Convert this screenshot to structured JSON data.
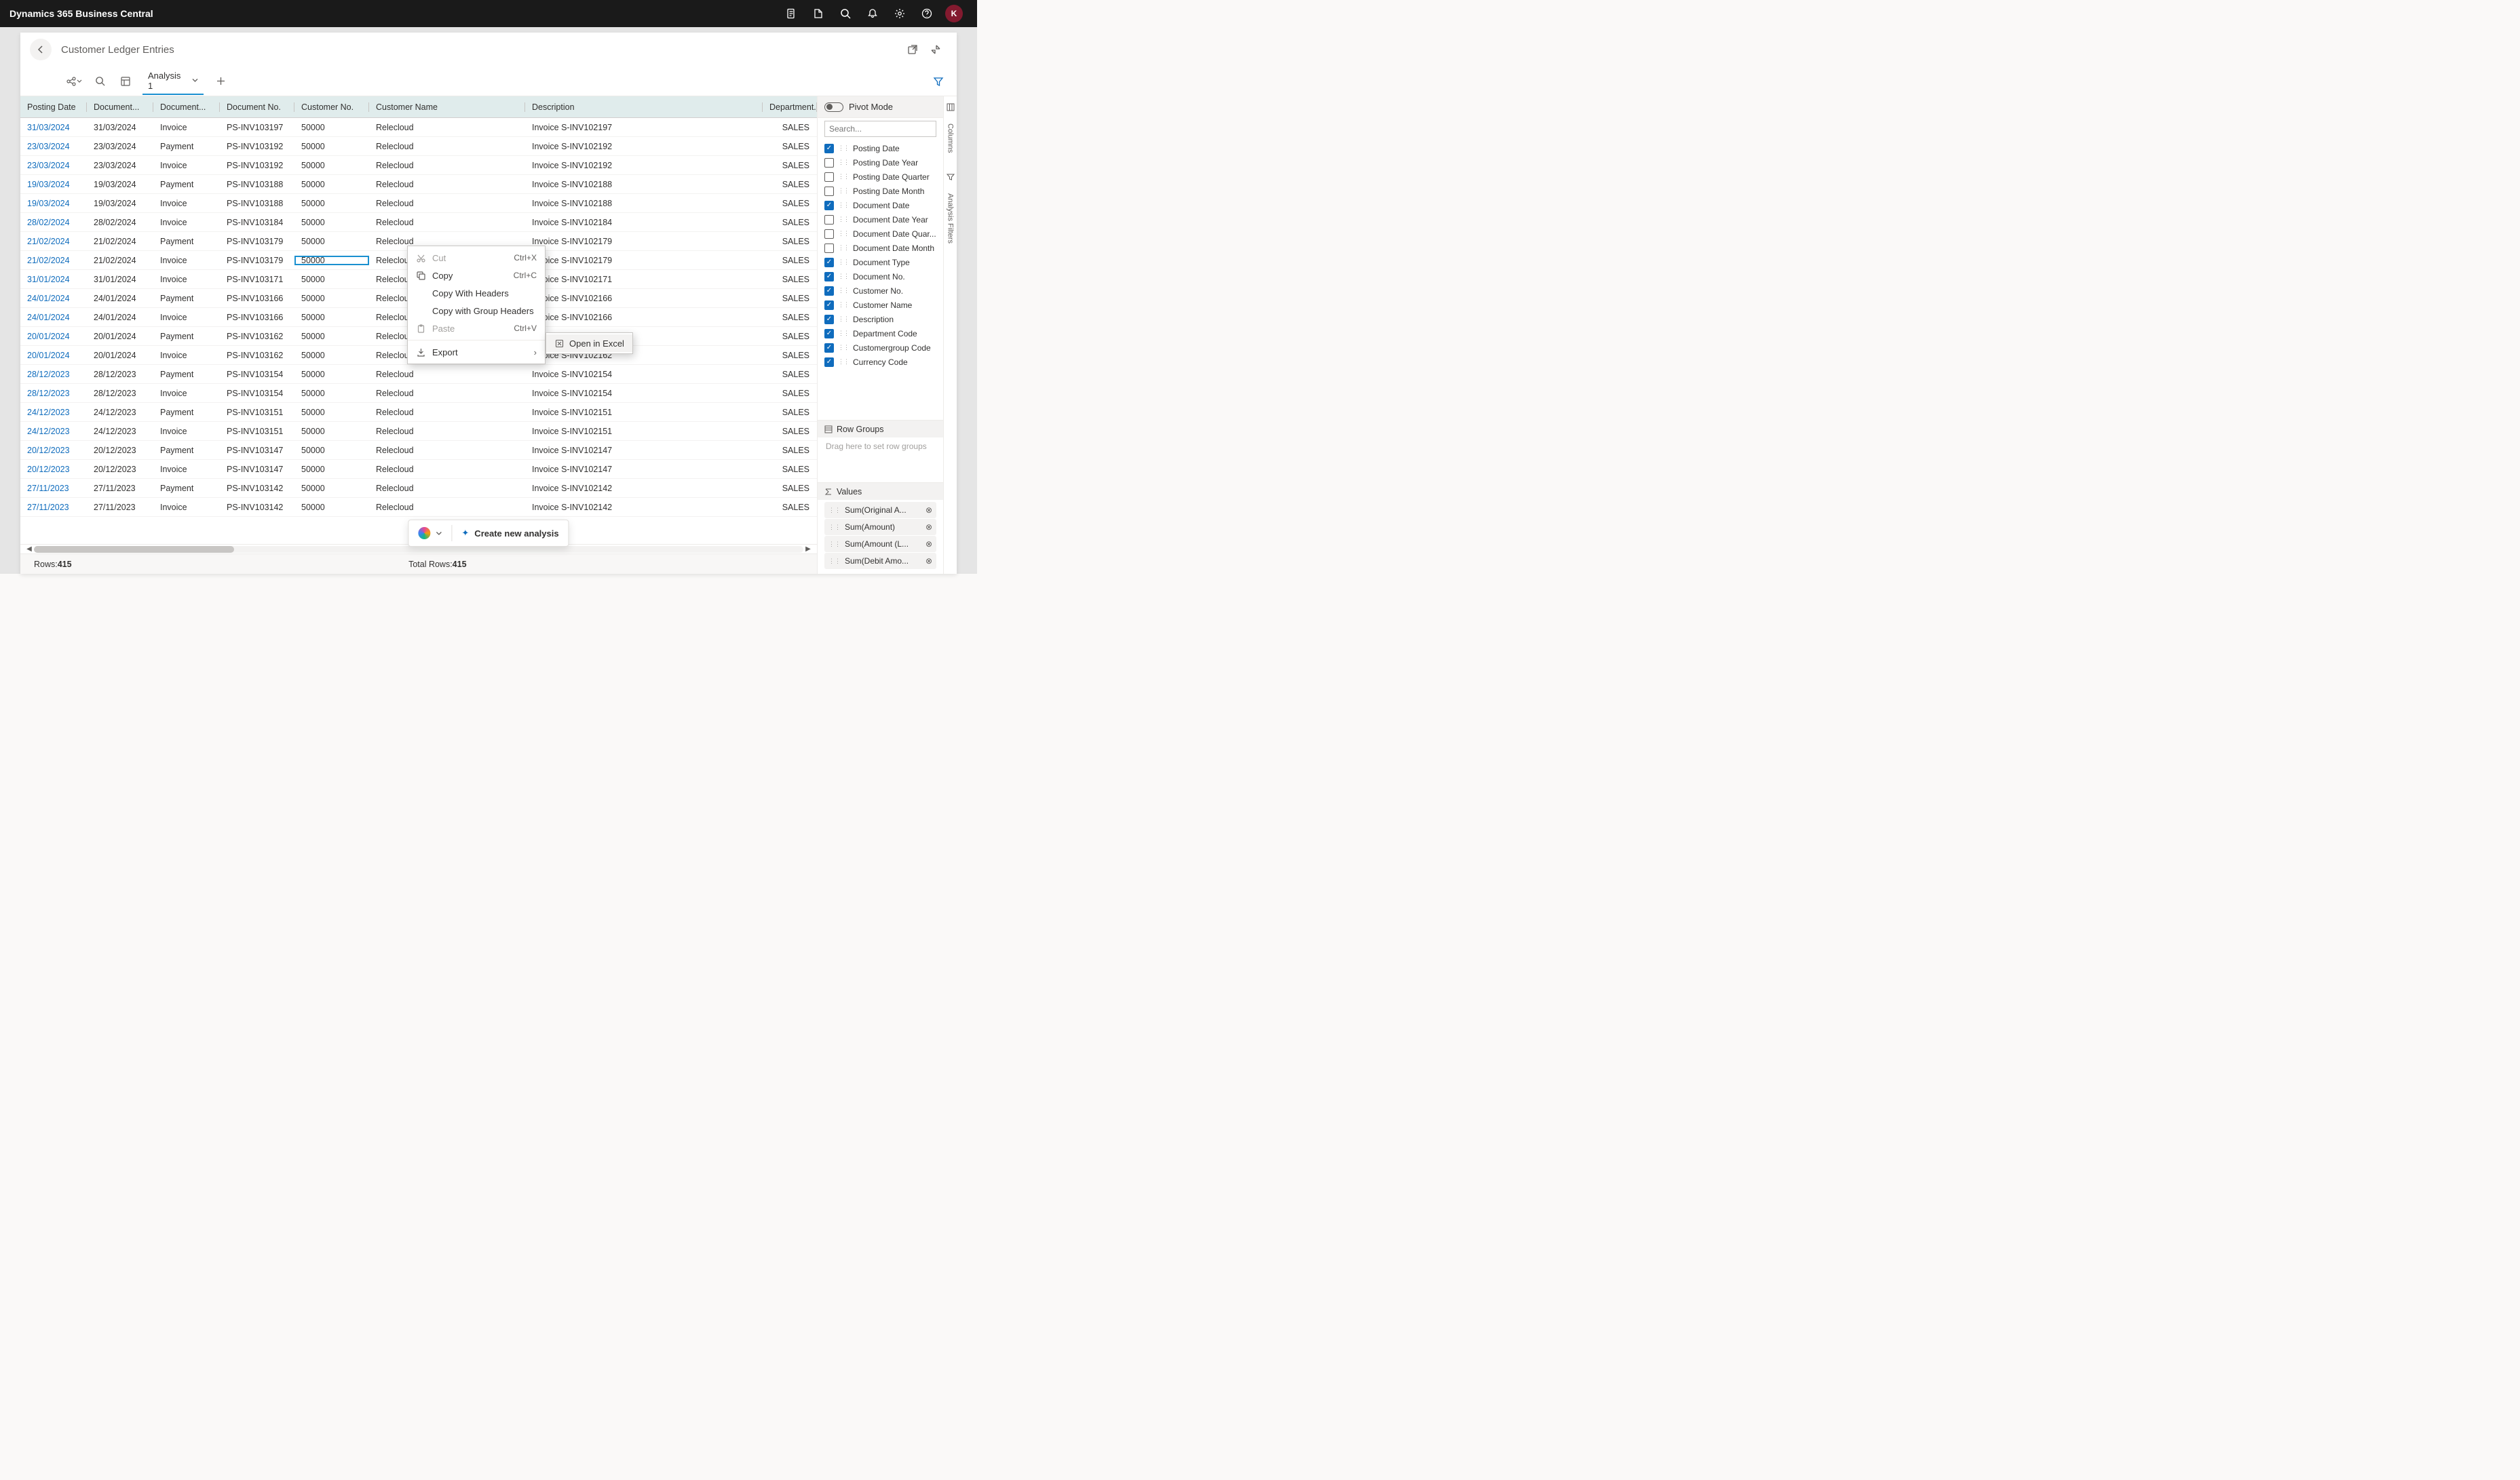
{
  "topbar": {
    "title": "Dynamics 365 Business Central",
    "avatar": "K"
  },
  "header": {
    "title": "Customer Ledger Entries"
  },
  "toolbar": {
    "tab": "Analysis 1"
  },
  "columns": {
    "posting_date": "Posting Date",
    "document_date": "Document...",
    "document_type": "Document...",
    "document_no": "Document No.",
    "customer_no": "Customer No.",
    "customer_name": "Customer Name",
    "description": "Description",
    "department": "Department..."
  },
  "rows": [
    {
      "pd": "31/03/2024",
      "dd": "31/03/2024",
      "dt": "Invoice",
      "dn": "PS-INV103197",
      "cn": "50000",
      "name": "Relecloud",
      "desc": "Invoice S-INV102197",
      "dept": "SALES"
    },
    {
      "pd": "23/03/2024",
      "dd": "23/03/2024",
      "dt": "Payment",
      "dn": "PS-INV103192",
      "cn": "50000",
      "name": "Relecloud",
      "desc": "Invoice S-INV102192",
      "dept": "SALES"
    },
    {
      "pd": "23/03/2024",
      "dd": "23/03/2024",
      "dt": "Invoice",
      "dn": "PS-INV103192",
      "cn": "50000",
      "name": "Relecloud",
      "desc": "Invoice S-INV102192",
      "dept": "SALES"
    },
    {
      "pd": "19/03/2024",
      "dd": "19/03/2024",
      "dt": "Payment",
      "dn": "PS-INV103188",
      "cn": "50000",
      "name": "Relecloud",
      "desc": "Invoice S-INV102188",
      "dept": "SALES"
    },
    {
      "pd": "19/03/2024",
      "dd": "19/03/2024",
      "dt": "Invoice",
      "dn": "PS-INV103188",
      "cn": "50000",
      "name": "Relecloud",
      "desc": "Invoice S-INV102188",
      "dept": "SALES"
    },
    {
      "pd": "28/02/2024",
      "dd": "28/02/2024",
      "dt": "Invoice",
      "dn": "PS-INV103184",
      "cn": "50000",
      "name": "Relecloud",
      "desc": "Invoice S-INV102184",
      "dept": "SALES"
    },
    {
      "pd": "21/02/2024",
      "dd": "21/02/2024",
      "dt": "Payment",
      "dn": "PS-INV103179",
      "cn": "50000",
      "name": "Relecloud",
      "desc": "Invoice S-INV102179",
      "dept": "SALES"
    },
    {
      "pd": "21/02/2024",
      "dd": "21/02/2024",
      "dt": "Invoice",
      "dn": "PS-INV103179",
      "cn": "50000",
      "name": "Relecloud",
      "desc": "Invoice S-INV102179",
      "dept": "SALES",
      "sel": true
    },
    {
      "pd": "31/01/2024",
      "dd": "31/01/2024",
      "dt": "Invoice",
      "dn": "PS-INV103171",
      "cn": "50000",
      "name": "Relecloud",
      "desc": "Invoice S-INV102171",
      "dept": "SALES"
    },
    {
      "pd": "24/01/2024",
      "dd": "24/01/2024",
      "dt": "Payment",
      "dn": "PS-INV103166",
      "cn": "50000",
      "name": "Relecloud",
      "desc": "Invoice S-INV102166",
      "dept": "SALES"
    },
    {
      "pd": "24/01/2024",
      "dd": "24/01/2024",
      "dt": "Invoice",
      "dn": "PS-INV103166",
      "cn": "50000",
      "name": "Relecloud",
      "desc": "Invoice S-INV102166",
      "dept": "SALES"
    },
    {
      "pd": "20/01/2024",
      "dd": "20/01/2024",
      "dt": "Payment",
      "dn": "PS-INV103162",
      "cn": "50000",
      "name": "Relecloud",
      "desc": "Invoice S-INV102162",
      "dept": "SALES"
    },
    {
      "pd": "20/01/2024",
      "dd": "20/01/2024",
      "dt": "Invoice",
      "dn": "PS-INV103162",
      "cn": "50000",
      "name": "Relecloud",
      "desc": "Invoice S-INV102162",
      "dept": "SALES"
    },
    {
      "pd": "28/12/2023",
      "dd": "28/12/2023",
      "dt": "Payment",
      "dn": "PS-INV103154",
      "cn": "50000",
      "name": "Relecloud",
      "desc": "Invoice S-INV102154",
      "dept": "SALES"
    },
    {
      "pd": "28/12/2023",
      "dd": "28/12/2023",
      "dt": "Invoice",
      "dn": "PS-INV103154",
      "cn": "50000",
      "name": "Relecloud",
      "desc": "Invoice S-INV102154",
      "dept": "SALES"
    },
    {
      "pd": "24/12/2023",
      "dd": "24/12/2023",
      "dt": "Payment",
      "dn": "PS-INV103151",
      "cn": "50000",
      "name": "Relecloud",
      "desc": "Invoice S-INV102151",
      "dept": "SALES"
    },
    {
      "pd": "24/12/2023",
      "dd": "24/12/2023",
      "dt": "Invoice",
      "dn": "PS-INV103151",
      "cn": "50000",
      "name": "Relecloud",
      "desc": "Invoice S-INV102151",
      "dept": "SALES"
    },
    {
      "pd": "20/12/2023",
      "dd": "20/12/2023",
      "dt": "Payment",
      "dn": "PS-INV103147",
      "cn": "50000",
      "name": "Relecloud",
      "desc": "Invoice S-INV102147",
      "dept": "SALES"
    },
    {
      "pd": "20/12/2023",
      "dd": "20/12/2023",
      "dt": "Invoice",
      "dn": "PS-INV103147",
      "cn": "50000",
      "name": "Relecloud",
      "desc": "Invoice S-INV102147",
      "dept": "SALES"
    },
    {
      "pd": "27/11/2023",
      "dd": "27/11/2023",
      "dt": "Payment",
      "dn": "PS-INV103142",
      "cn": "50000",
      "name": "Relecloud",
      "desc": "Invoice S-INV102142",
      "dept": "SALES"
    },
    {
      "pd": "27/11/2023",
      "dd": "27/11/2023",
      "dt": "Invoice",
      "dn": "PS-INV103142",
      "cn": "50000",
      "name": "Relecloud",
      "desc": "Invoice S-INV102142",
      "dept": "SALES"
    }
  ],
  "footer": {
    "rows_label": "Rows: ",
    "rows_count": "415",
    "total_label": "Total Rows: ",
    "total_count": "415"
  },
  "side": {
    "pivot_label": "Pivot Mode",
    "search_placeholder": "Search...",
    "fields": [
      {
        "name": "Posting Date",
        "checked": true
      },
      {
        "name": "Posting Date Year",
        "checked": false
      },
      {
        "name": "Posting Date Quarter",
        "checked": false
      },
      {
        "name": "Posting Date Month",
        "checked": false
      },
      {
        "name": "Document Date",
        "checked": true
      },
      {
        "name": "Document Date Year",
        "checked": false
      },
      {
        "name": "Document Date Quar...",
        "checked": false
      },
      {
        "name": "Document Date Month",
        "checked": false
      },
      {
        "name": "Document Type",
        "checked": true
      },
      {
        "name": "Document No.",
        "checked": true
      },
      {
        "name": "Customer No.",
        "checked": true
      },
      {
        "name": "Customer Name",
        "checked": true
      },
      {
        "name": "Description",
        "checked": true
      },
      {
        "name": "Department Code",
        "checked": true
      },
      {
        "name": "Customergroup Code",
        "checked": true
      },
      {
        "name": "Currency Code",
        "checked": true
      }
    ],
    "row_groups_label": "Row Groups",
    "row_groups_hint": "Drag here to set row groups",
    "values_label": "Values",
    "values": [
      "Sum(Original A...",
      "Sum(Amount)",
      "Sum(Amount (L...",
      "Sum(Debit Amo..."
    ]
  },
  "side_tabs": {
    "columns": "Columns",
    "filters": "Analysis Filters"
  },
  "ctx": {
    "cut": "Cut",
    "cut_kbd": "Ctrl+X",
    "copy": "Copy",
    "copy_kbd": "Ctrl+C",
    "copy_headers": "Copy With Headers",
    "copy_group": "Copy with Group Headers",
    "paste": "Paste",
    "paste_kbd": "Ctrl+V",
    "export": "Export",
    "open_excel": "Open in Excel"
  },
  "fab": {
    "create": "Create new analysis"
  }
}
